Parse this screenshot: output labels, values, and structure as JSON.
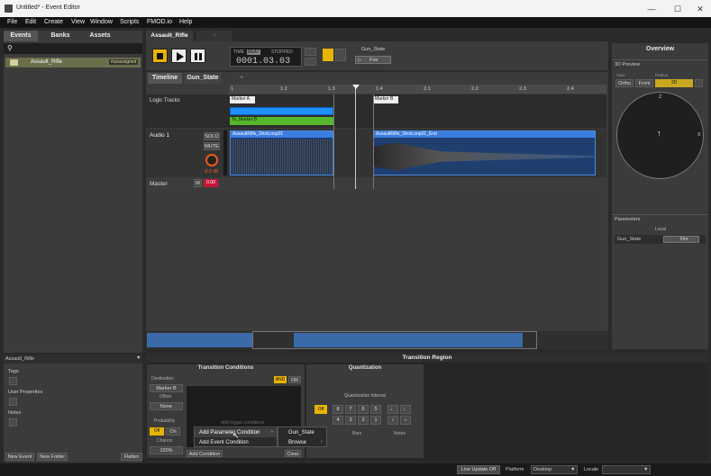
{
  "window": {
    "title": "Untitled* - Event Editor",
    "min": "—",
    "max": "☐",
    "close": "✕"
  },
  "menu": [
    "File",
    "Edit",
    "Create",
    "View",
    "Window",
    "Scripts",
    "FMOD.io",
    "Help"
  ],
  "browser": {
    "tabs": [
      "Events",
      "Banks",
      "Assets"
    ],
    "search_icon": "search-icon",
    "event_name": "Assault_Rifle",
    "event_badge": "#unassigned"
  },
  "props": {
    "title": "Assault_Rifle",
    "tags": "Tags",
    "user_props": "User Properties",
    "notes": "Notes",
    "new_event": "New Event",
    "new_folder": "New Folder",
    "flatten": "Flatten"
  },
  "editor": {
    "event_tab": "Assault_Rifle",
    "add_tab": "+",
    "time_label": "TIME",
    "beat_label": "BEAT",
    "state": "STOPPED",
    "time_value": "0001.03.03",
    "param_name": "Gun_State",
    "param_value": "Fire"
  },
  "timeline": {
    "tabs": [
      "Timeline",
      "Gun_State",
      "+"
    ],
    "ruler": [
      "1",
      "1.2",
      "1.3",
      "1.4",
      "2.1",
      "2.2",
      "2.3",
      "2.4"
    ],
    "logic_tracks": "Logic Tracks",
    "marker_a": "Marker A",
    "marker_b": "Marker B",
    "transition": "To_Marker B",
    "audio_track": "Audio 1",
    "solo": "SOLO",
    "mute": "MUTE",
    "volume": "-8.5 dB",
    "clip1": "AssaultRifle_ShotLoop01",
    "clip2": "AssaultRifle_ShotLoop01_End",
    "master": "Master",
    "m": "M",
    "master_level": "0.00"
  },
  "overview": {
    "title": "Overview",
    "preview": "3D Preview",
    "view_lbl": "View",
    "radius_lbl": "Radius",
    "ortho": "Ortho",
    "front": "Front",
    "radius": "20",
    "z": "Z",
    "x": "X",
    "params": "Parameters",
    "local": "Local",
    "param_name": "Gun_State",
    "param_value": "Fire"
  },
  "transition": {
    "title": "Transition Region",
    "conditions": "Transition Conditions",
    "quantization": "Quantization",
    "destination": "Destination",
    "dest_value": "Marker B",
    "offset": "Offset",
    "offset_value": "None",
    "probability": "Probability",
    "off": "Off",
    "on": "On",
    "chance": "Chance",
    "chance_value": "100%",
    "and": "AND",
    "or": "OR",
    "hint": "Add trigger conditions",
    "add_condition": "Add Condition",
    "interval": "Quantization Interval",
    "q_off": "Off",
    "bars_row1": [
      "8",
      "7",
      "6",
      "5"
    ],
    "bars_row2": [
      "4",
      "3",
      "2",
      "1"
    ],
    "bars": "Bars",
    "notes": "Notes",
    "clear": "Clear"
  },
  "context_menu": {
    "item1": "Add Parameter Condition",
    "item2": "Add Event Condition",
    "sub1": "Gun_State",
    "sub2": "Browse"
  },
  "status": {
    "live_update": "Live Update Off",
    "platform_lbl": "Platform",
    "platform": "Desktop",
    "locale_lbl": "Locale",
    "locale": ""
  }
}
